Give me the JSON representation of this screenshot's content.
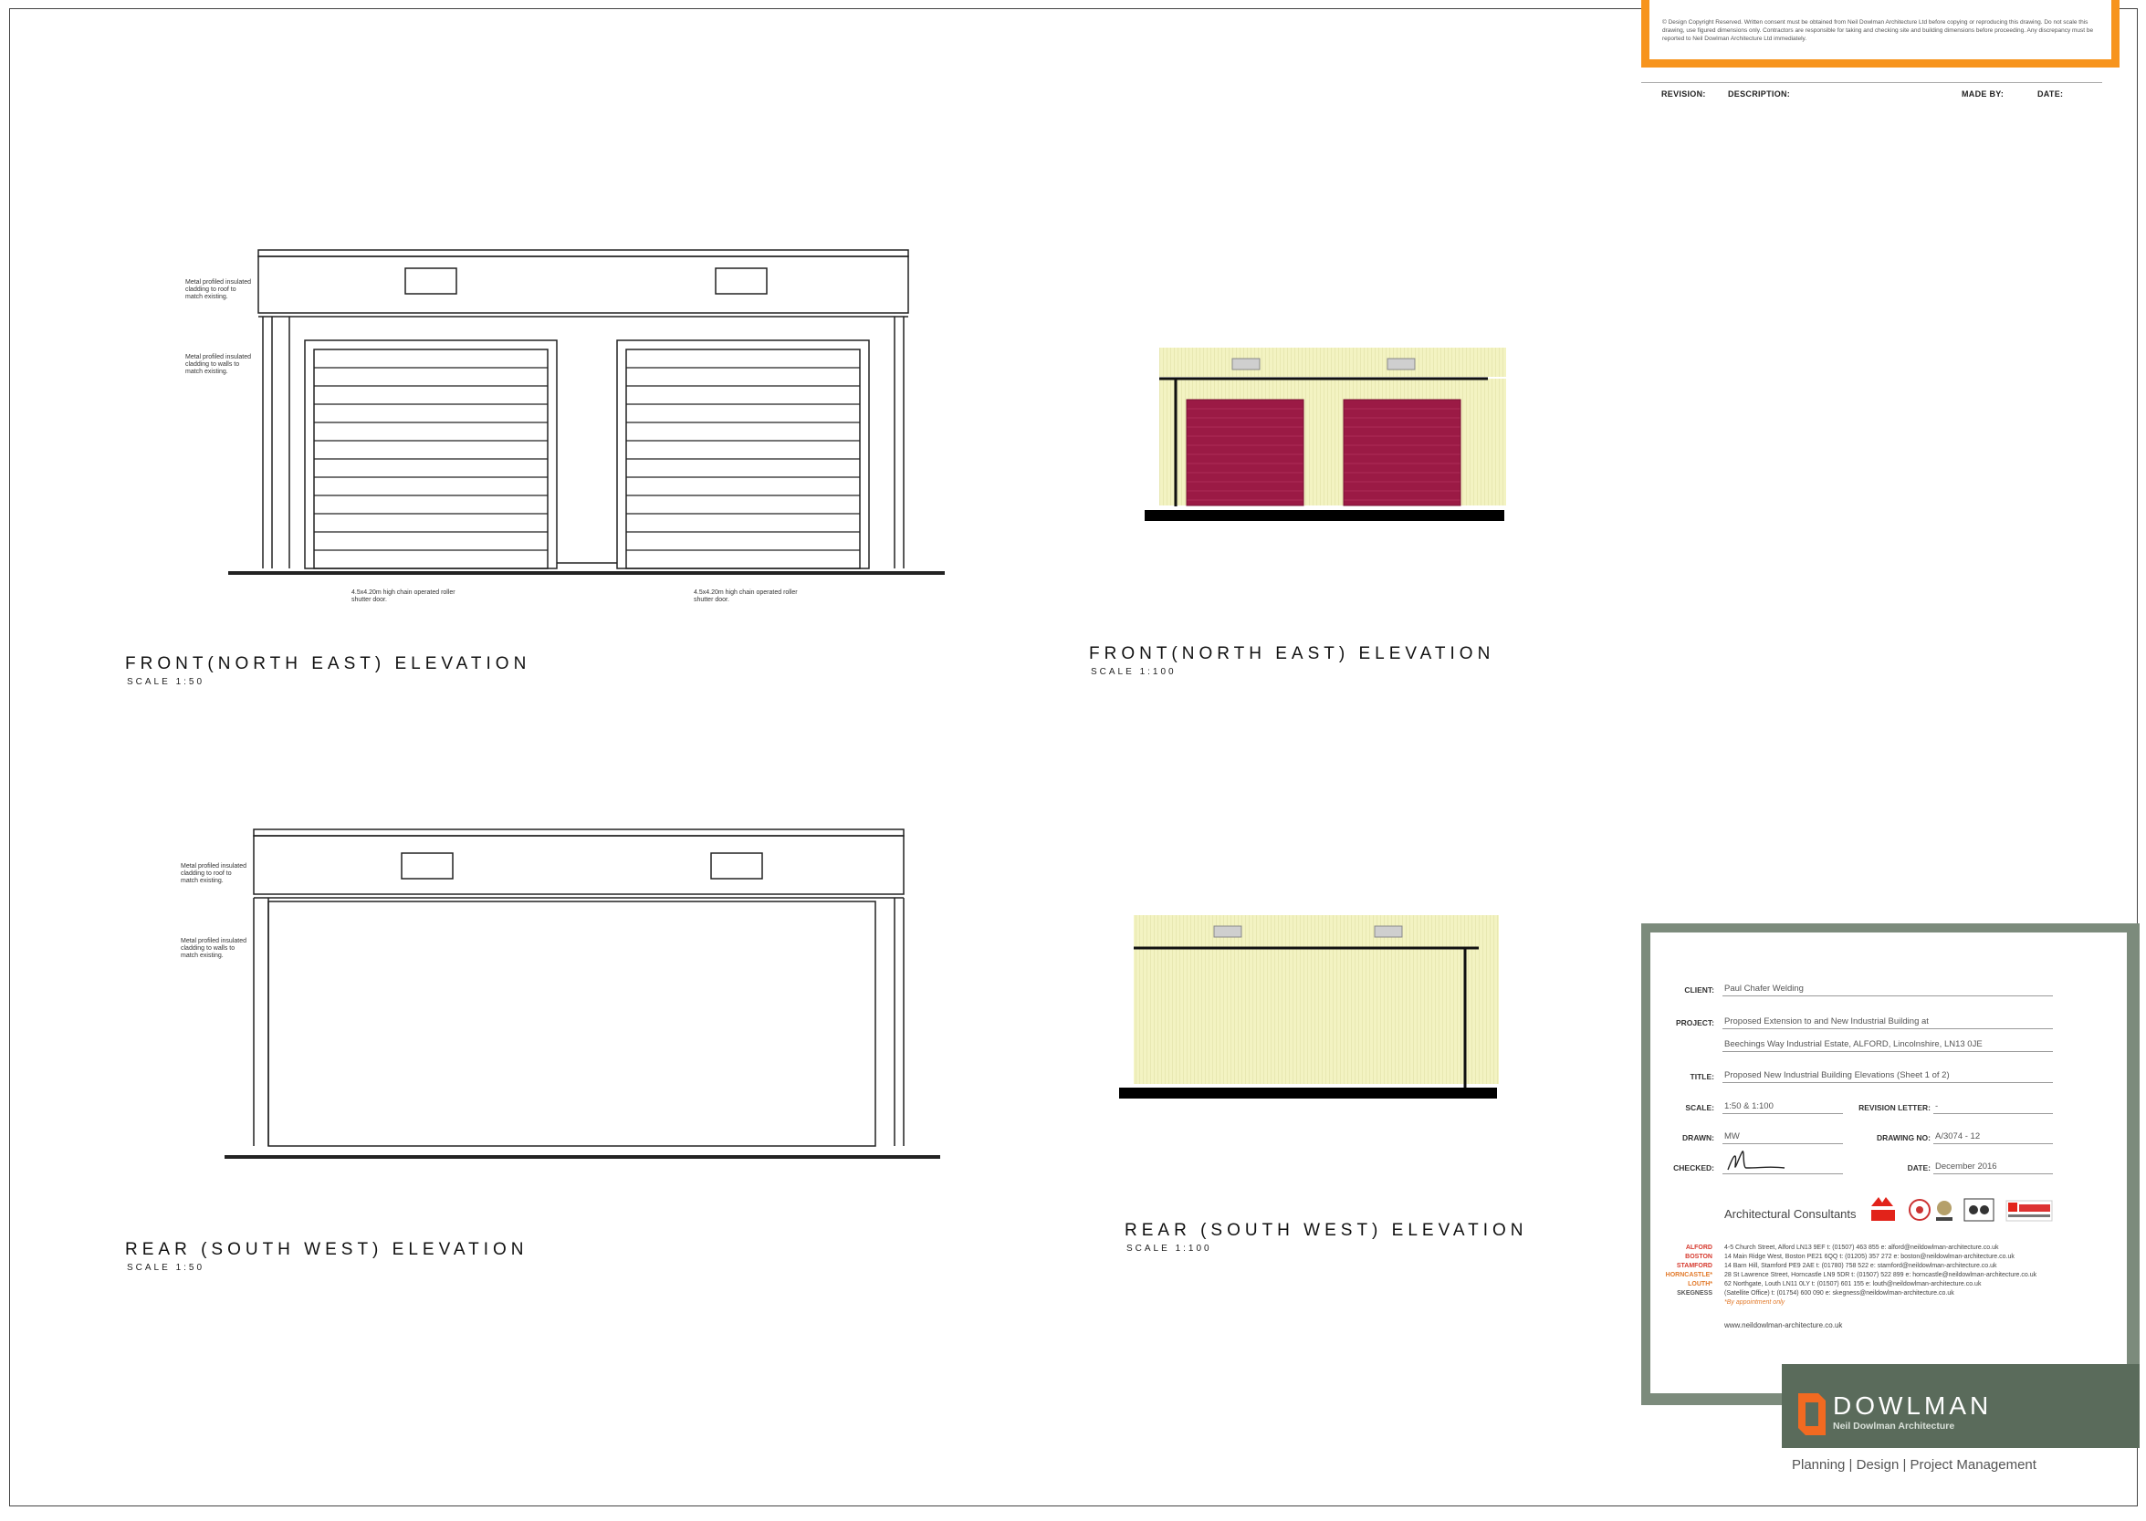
{
  "notice": {
    "text": "© Design Copyright Reserved. Written consent must be obtained from Neil Dowlman Architecture Ltd before copying or reproducing this drawing. Do not scale this drawing, use figured dimensions only. Contractors are responsible for taking and checking site and building dimensions before proceeding. Any discrepancy must be reported to Neil Dowlman Architecture Ltd immediately."
  },
  "revision_table": {
    "revision": "REVISION:",
    "description": "DESCRIPTION:",
    "made_by": "MADE BY:",
    "date": "DATE:"
  },
  "views": {
    "front_150": {
      "title": "FRONT(NORTH EAST) ELEVATION",
      "scale": "SCALE 1:50",
      "note_roof": "Metal profiled insulated cladding to roof to match existing.",
      "note_walls": "Metal profiled insulated cladding to walls to match existing.",
      "door_note_left": "4.5x4.20m high chain operated roller shutter door.",
      "door_note_right": "4.5x4.20m high chain operated roller shutter door."
    },
    "front_1100": {
      "title": "FRONT(NORTH EAST) ELEVATION",
      "scale": "SCALE 1:100"
    },
    "rear_150": {
      "title": "REAR (SOUTH WEST) ELEVATION",
      "scale": "SCALE 1:50",
      "note_roof": "Metal profiled insulated cladding to roof to match existing.",
      "note_walls": "Metal profiled insulated cladding to walls to match existing."
    },
    "rear_1100": {
      "title": "REAR (SOUTH WEST) ELEVATION",
      "scale": "SCALE 1:100"
    }
  },
  "title_block": {
    "client_label": "CLIENT:",
    "client": "Paul Chafer Welding",
    "project_label": "PROJECT:",
    "project_line1": "Proposed Extension to and New Industrial Building at",
    "project_line2": "Beechings Way Industrial Estate, ALFORD, Lincolnshire, LN13 0JE",
    "title_label": "TITLE:",
    "title": "Proposed New Industrial Building Elevations (Sheet 1 of 2)",
    "scale_label": "SCALE:",
    "scale": "1:50 & 1:100",
    "revision_letter_label": "REVISION LETTER:",
    "revision_letter": "-",
    "drawn_label": "DRAWN:",
    "drawn": "MW",
    "drawing_no_label": "DRAWING NO:",
    "drawing_no": "A/3074 - 12",
    "checked_label": "CHECKED:",
    "date_label": "DATE:",
    "date": "December 2016",
    "consultants": "Architectural Consultants",
    "offices": [
      {
        "name": "ALFORD",
        "addr": "4-5 Church Street, Alford LN13 9EF  t: (01507) 463 855  e: alford@neildowlman-architecture.co.uk"
      },
      {
        "name": "BOSTON",
        "addr": "14 Main Ridge West, Boston PE21 6QQ  t: (01205) 357 272  e: boston@neildowlman-architecture.co.uk"
      },
      {
        "name": "STAMFORD",
        "addr": "14 Barn Hill, Stamford PE9 2AE  t: (01780) 758 522  e: stamford@neildowlman-architecture.co.uk"
      },
      {
        "name": "HORNCASTLE*",
        "addr": "28 St Lawrence Street, Horncastle LN9 5DR  t: (01507) 522 899  e: horncastle@neildowlman-architecture.co.uk"
      },
      {
        "name": "LOUTH*",
        "addr": "62 Northgate, Louth LN11 0LY  t: (01507) 601 155  e: louth@neildowlman-architecture.co.uk"
      },
      {
        "name": "SKEGNESS",
        "addr": "(Satellite Office)  t: (01754) 600 090  e: skegness@neildowlman-architecture.co.uk"
      }
    ],
    "appointment": "*By appointment only",
    "website": "www.neildowlman-architecture.co.uk",
    "brand": "DOWLMAN",
    "brand_sub": "Neil Dowlman Architecture",
    "tagline": "Planning | Design | Project Management"
  },
  "colors": {
    "accent_orange": "#f7941d",
    "title_block_green": "#7c8b7c",
    "logo_green": "#5a6b5b",
    "cladding_yellow": "#f3f3c2",
    "shutter_red": "#9b1a45"
  }
}
